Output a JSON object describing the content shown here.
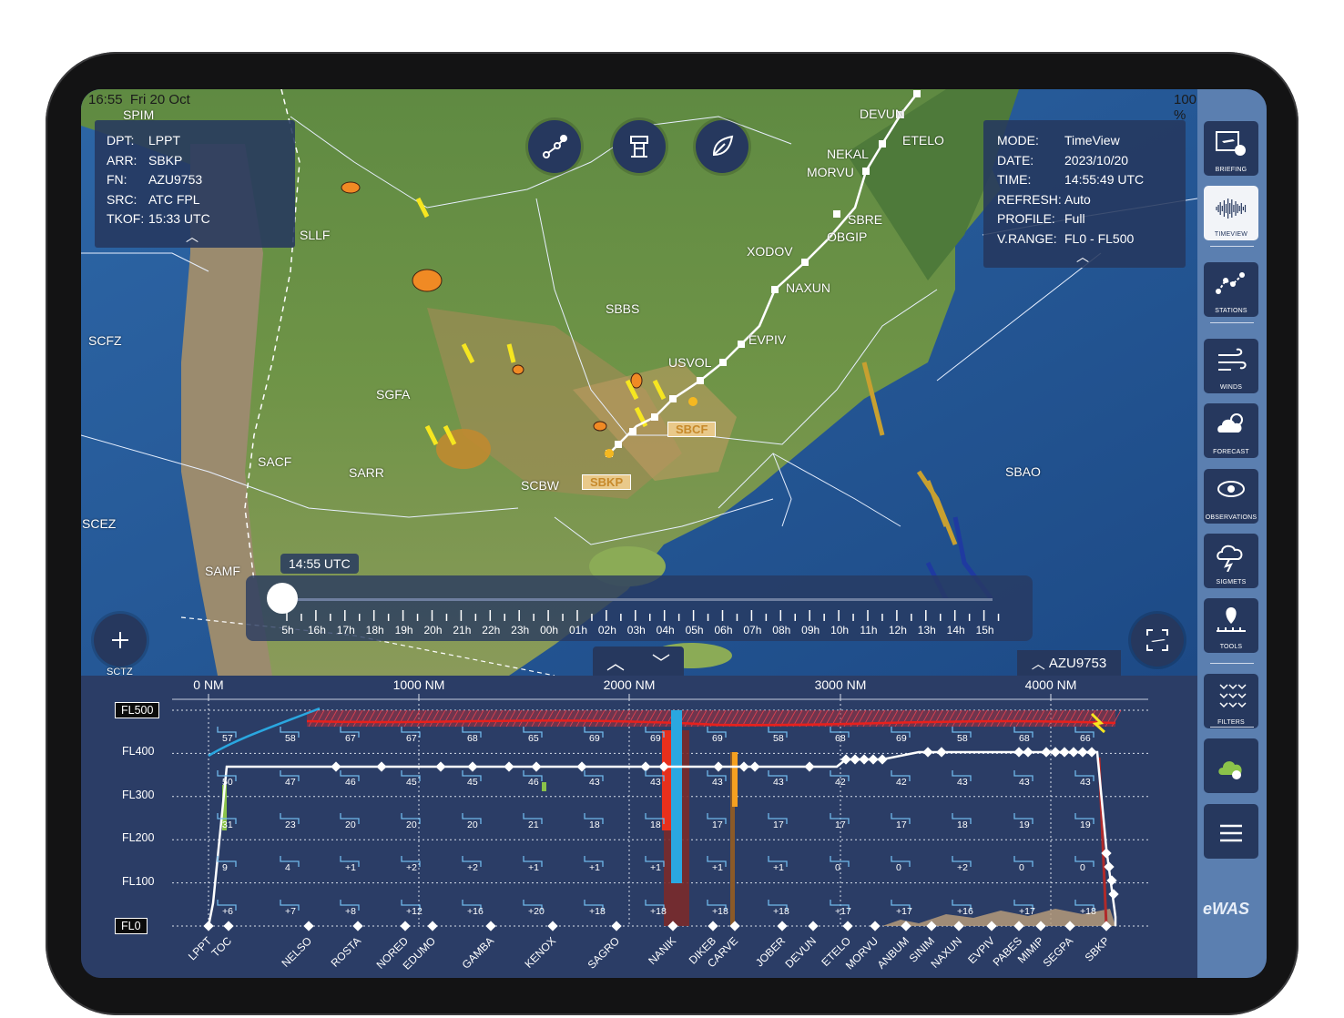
{
  "status": {
    "time": "16:55",
    "date": "Fri 20 Oct",
    "battery": "100 %"
  },
  "flight_info": [
    {
      "k": "DPT:",
      "v": "LPPT"
    },
    {
      "k": "ARR:",
      "v": "SBKP"
    },
    {
      "k": "FN:",
      "v": "AZU9753"
    },
    {
      "k": "SRC:",
      "v": "ATC FPL"
    },
    {
      "k": "TKOF:",
      "v": "15:33 UTC"
    }
  ],
  "mode_info": [
    {
      "k": "MODE:",
      "v": "TimeView"
    },
    {
      "k": "DATE:",
      "v": "2023/10/20"
    },
    {
      "k": "TIME:",
      "v": "14:55:49 UTC"
    },
    {
      "k": "REFRESH:",
      "v": "Auto"
    },
    {
      "k": "PROFILE:",
      "v": "Full"
    },
    {
      "k": "V.RANGE:",
      "v": "FL0 - FL500"
    }
  ],
  "map_labels": {
    "stations": [
      "SPIM",
      "SLLF",
      "SCFZ",
      "SBBS",
      "SGFA",
      "SACF",
      "SARR",
      "SCBW",
      "SCEZ",
      "SAMF",
      "SBAO",
      "SCTZ"
    ],
    "highlighted_stations": [
      "SBCF",
      "SBKP"
    ],
    "waypoints": [
      "DEVUN",
      "ETELO",
      "NEKAL",
      "MORVU",
      "SBRE",
      "OBGIP",
      "XODOV",
      "NAXUN",
      "EVPIV",
      "USVOL"
    ],
    "flight_tag": "AZU9753"
  },
  "timeline": {
    "current": "14:55 UTC",
    "ticks": [
      "5h",
      "16h",
      "17h",
      "18h",
      "19h",
      "20h",
      "21h",
      "22h",
      "23h",
      "00h",
      "01h",
      "02h",
      "03h",
      "04h",
      "05h",
      "06h",
      "07h",
      "08h",
      "09h",
      "10h",
      "11h",
      "12h",
      "13h",
      "14h",
      "15h"
    ]
  },
  "profile": {
    "distance_labels": [
      "0 NM",
      "1000 NM",
      "2000 NM",
      "3000 NM",
      "4000 NM"
    ],
    "fl_labels": [
      "FL500",
      "FL400",
      "FL300",
      "FL200",
      "FL100",
      "FL0"
    ],
    "waypoints": [
      "LPPT",
      "TOC",
      "NELSO",
      "ROSTA",
      "NORED",
      "EDUMO",
      "GAMBA",
      "KENOX",
      "SAGRO",
      "NANIK",
      "DIKEB",
      "CARVE",
      "JOBER",
      "DEVUN",
      "ETELO",
      "MORVU",
      "ANBUM",
      "SINIM",
      "NAXUN",
      "EVPIV",
      "PABES",
      "MIMIP",
      "SEGPA",
      "SBKP"
    ],
    "temp_rows": [
      [
        "57",
        "58",
        "67",
        "67",
        "68",
        "65",
        "69",
        "69",
        "69",
        "58",
        "68",
        "69",
        "58",
        "68",
        "66"
      ],
      [
        "50",
        "47",
        "46",
        "45",
        "45",
        "46",
        "43",
        "43",
        "43",
        "43",
        "42",
        "42",
        "43",
        "43",
        "43"
      ],
      [
        "31",
        "23",
        "20",
        "20",
        "20",
        "21",
        "18",
        "18",
        "17",
        "17",
        "17",
        "17",
        "18",
        "19",
        "19"
      ],
      [
        "9",
        "4",
        "+1",
        "+2",
        "+2",
        "+1",
        "+1",
        "+1",
        "+1",
        "+1",
        "0",
        "0",
        "+2",
        "0",
        "0"
      ],
      [
        "+6",
        "+7",
        "+8",
        "+12",
        "+16",
        "+20",
        "+18",
        "+18",
        "+18",
        "+18",
        "+17",
        "+17",
        "+16",
        "+17",
        "+18"
      ]
    ]
  },
  "sidebar": [
    {
      "label": "BRIEFING",
      "icon": "briefing-icon"
    },
    {
      "label": "TIMEVIEW",
      "icon": "timeview-icon"
    },
    {
      "label": "STATIONS",
      "icon": "stations-icon"
    },
    {
      "label": "WINDS",
      "icon": "winds-icon"
    },
    {
      "label": "FORECAST",
      "icon": "forecast-icon"
    },
    {
      "label": "OBSERVATIONS",
      "icon": "observations-icon"
    },
    {
      "label": "SIGMETS",
      "icon": "sigmets-icon"
    },
    {
      "label": "TOOLS",
      "icon": "tools-icon"
    },
    {
      "label": "FILTERS",
      "icon": "filters-icon"
    }
  ],
  "logo": "eWAS",
  "colors": {
    "panel": "#26385e",
    "sidebar": "#5b7fb0",
    "route": "#ffffff",
    "tropopause": "#e0201c",
    "jet": "#2aa7e0"
  }
}
